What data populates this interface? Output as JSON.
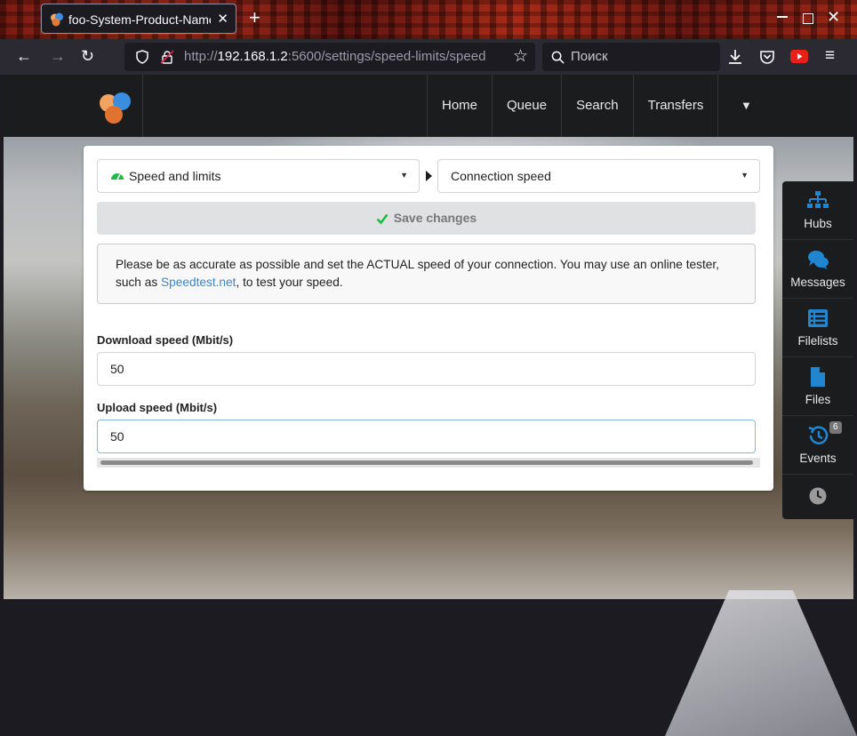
{
  "browser": {
    "tab_title": "foo-System-Product-Name",
    "url_prefix": "http://",
    "url_host": "192.168.1.2",
    "url_rest": ":5600/settings/speed-limits/speed",
    "search_placeholder": "Поиск",
    "icons": [
      "back-icon",
      "forward-icon",
      "reload-icon",
      "shield-icon",
      "lock-icon",
      "bookmark-star-icon",
      "search-icon",
      "download-icon",
      "pocket-icon",
      "youtube-icon",
      "hamburger-menu-icon"
    ]
  },
  "header": {
    "menu": [
      {
        "label": "Home"
      },
      {
        "label": "Queue"
      },
      {
        "label": "Search"
      },
      {
        "label": "Transfers"
      }
    ]
  },
  "settings": {
    "section_dropdown": "Speed and limits",
    "page_dropdown": "Connection speed",
    "save_label": "Save changes",
    "message_before": "Please be as accurate as possible and set the ACTUAL speed of your connection. You may use an online tester, such as ",
    "message_link": "Speedtest.net",
    "message_after": ", to test your speed.",
    "download_label": "Download speed (Mbit/s)",
    "download_value": "50",
    "upload_label": "Upload speed (Mbit/s)",
    "upload_value": "50"
  },
  "sidebar": {
    "items": [
      {
        "label": "Hubs"
      },
      {
        "label": "Messages"
      },
      {
        "label": "Filelists"
      },
      {
        "label": "Files"
      },
      {
        "label": "Events",
        "badge": "6"
      }
    ]
  },
  "colors": {
    "accent_blue": "#2185d0",
    "success_green": "#21ba45",
    "link": "#4183c4"
  }
}
